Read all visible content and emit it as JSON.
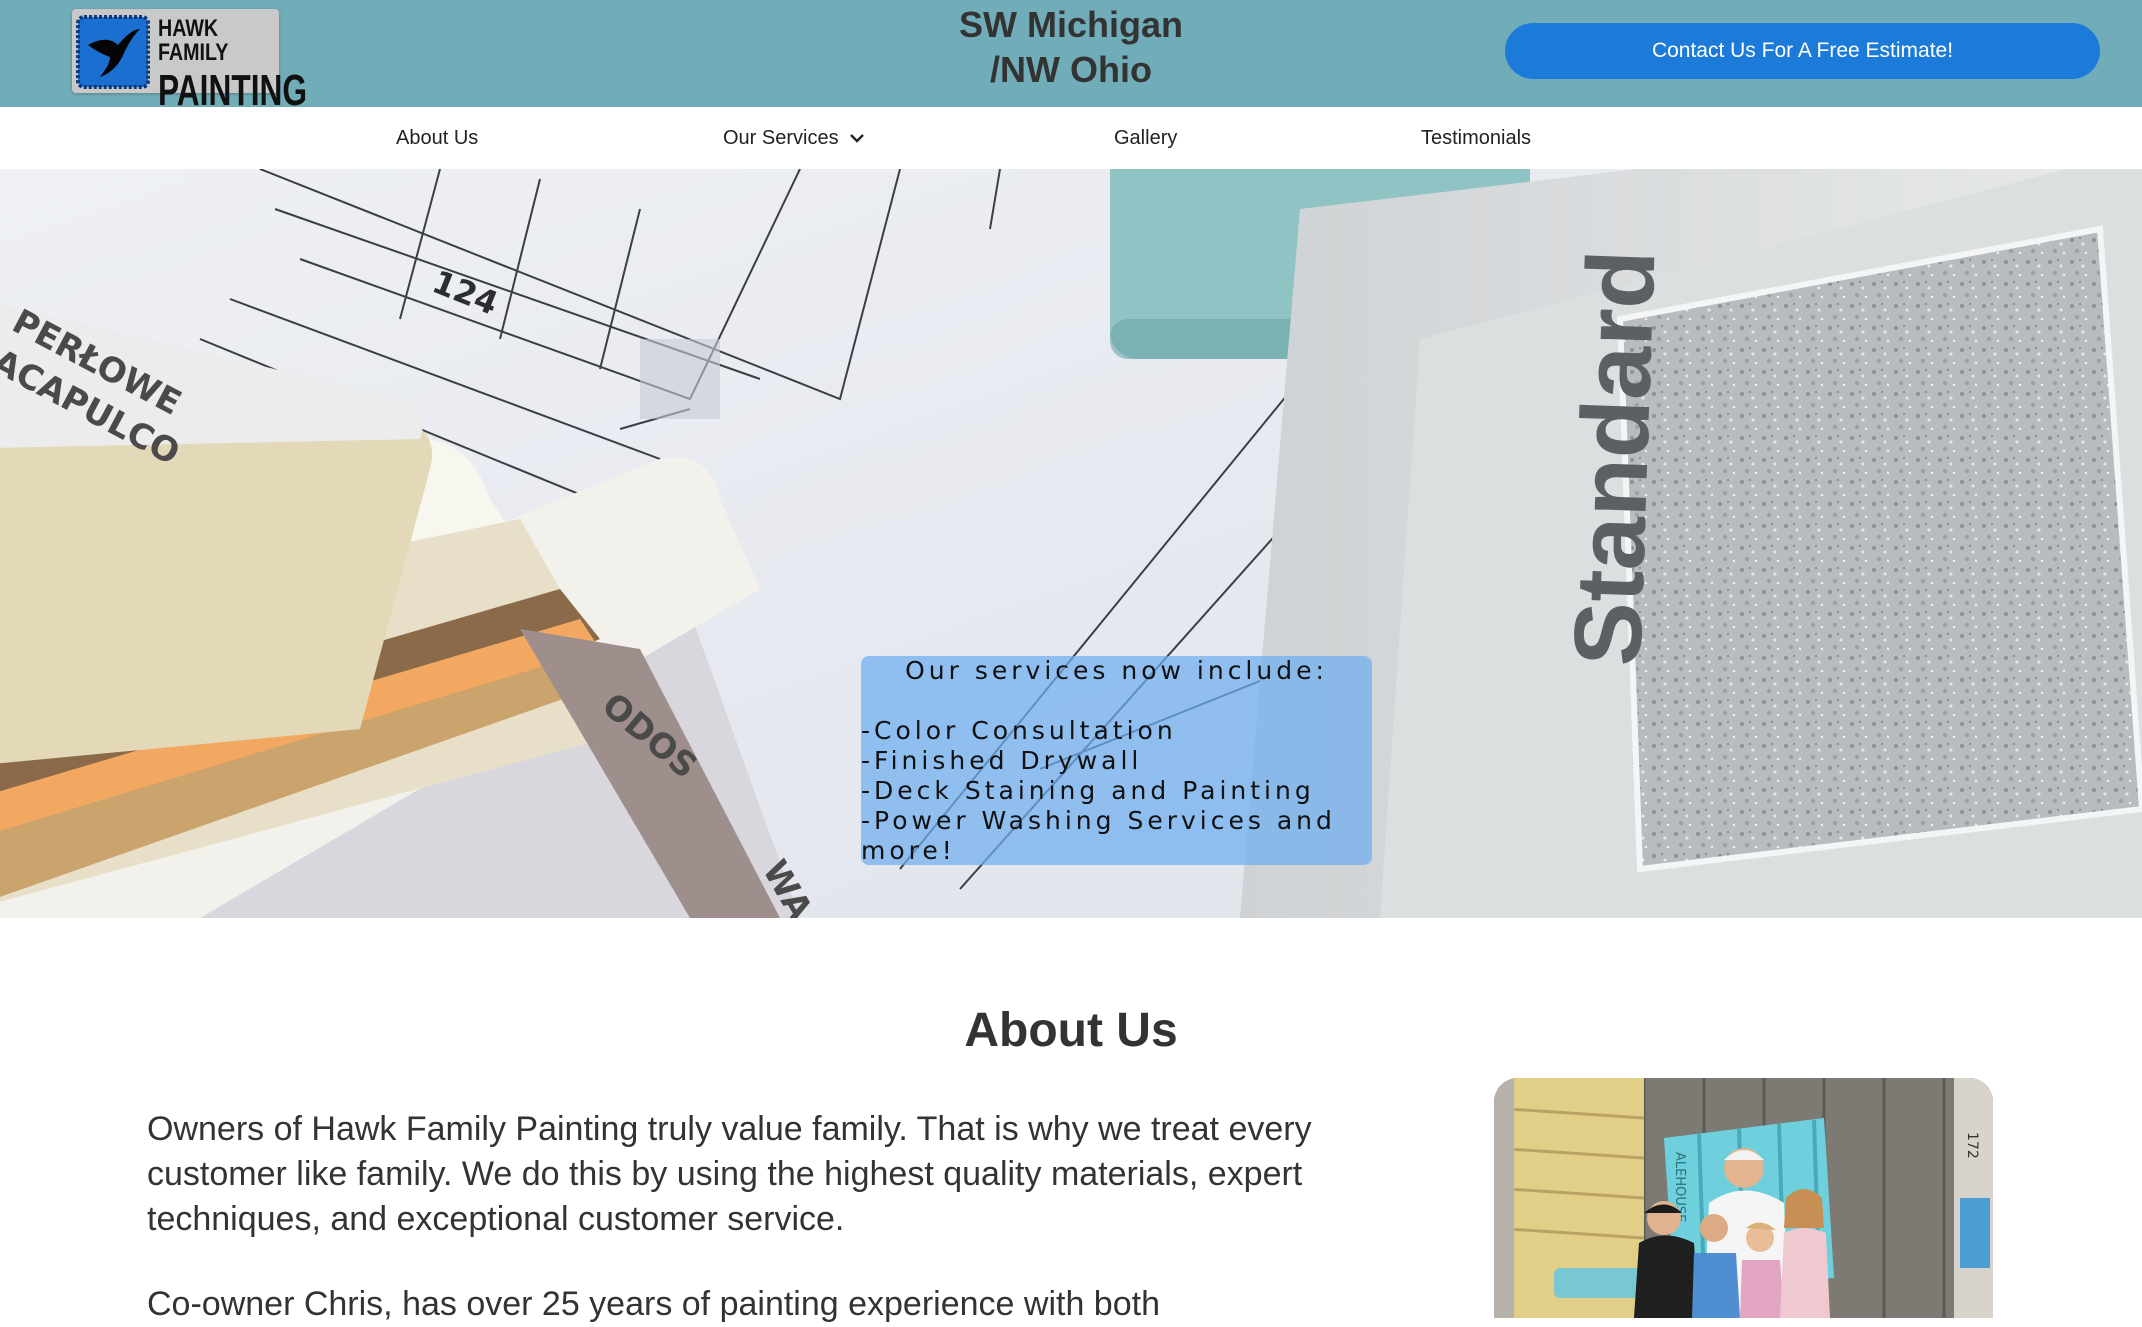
{
  "header": {
    "logo_line1": "HAWK FAMILY",
    "logo_line2": "PAINTING",
    "region_line1": "SW Michigan",
    "region_line2": "/NW Ohio",
    "cta_label": "Contact Us For A Free Estimate!"
  },
  "nav": {
    "items": [
      {
        "label": "About Us"
      },
      {
        "label": "Our Services",
        "has_dropdown": true
      },
      {
        "label": "Gallery"
      },
      {
        "label": "Testimonials"
      }
    ]
  },
  "hero": {
    "swatch_texts": [
      "PERŁOWE",
      "ACAPULCO",
      "ODOS",
      "WA"
    ],
    "drawing_label": "124",
    "sample_label": "Standard",
    "promo": {
      "heading": "Our services now include:",
      "lines": [
        "-Color Consultation",
        "-Finished Drywall",
        "-Deck Staining and Painting",
        "-Power Washing Services and more!"
      ]
    }
  },
  "about": {
    "title": "About Us",
    "paragraph1": "Owners of Hawk Family Painting truly value family. That is why we treat every customer like family. We do this by using the highest quality materials, expert techniques, and exceptional customer service.",
    "paragraph2": "Co-owner Chris, has over 25 years of painting experience with both",
    "photo_sign_left": "ALEHOUSE",
    "photo_sign_right": "172"
  },
  "colors": {
    "header_bg": "#71adb9",
    "cta_bg": "#1c7ad9",
    "promo_bg": "#6eaff0"
  }
}
